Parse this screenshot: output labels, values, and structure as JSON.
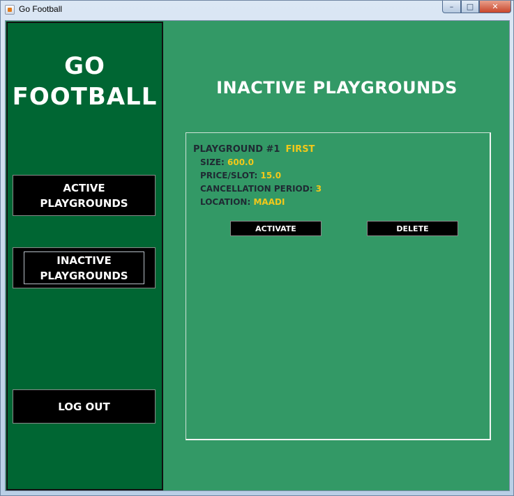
{
  "window": {
    "title": "Go Football",
    "controls": {
      "minimize": "–",
      "maximize": "□",
      "close": "✕"
    }
  },
  "sidebar": {
    "logo_line1": "GO",
    "logo_line2": "FOOTBALL",
    "active_line1": "ACTIVE",
    "active_line2": "PLAYGROUNDS",
    "inactive_line1": "INACTIVE",
    "inactive_line2": "PLAYGROUNDS",
    "logout": "LOG OUT"
  },
  "main": {
    "title": "INACTIVE PLAYGROUNDS",
    "playground": {
      "header_label": "PLAYGROUND #1",
      "name": "FIRST",
      "size_label": "SIZE:",
      "size_value": "600.0",
      "price_label": "PRICE/SLOT:",
      "price_value": "15.0",
      "cancel_label": "CANCELLATION PERIOD:",
      "cancel_value": "3",
      "location_label": "LOCATION:",
      "location_value": "MAADI"
    },
    "activate": "ACTIVATE",
    "delete": "DELETE"
  },
  "colors": {
    "sidebar": "#006633",
    "background": "#339966",
    "value": "#f2c81a",
    "button": "#000000"
  }
}
